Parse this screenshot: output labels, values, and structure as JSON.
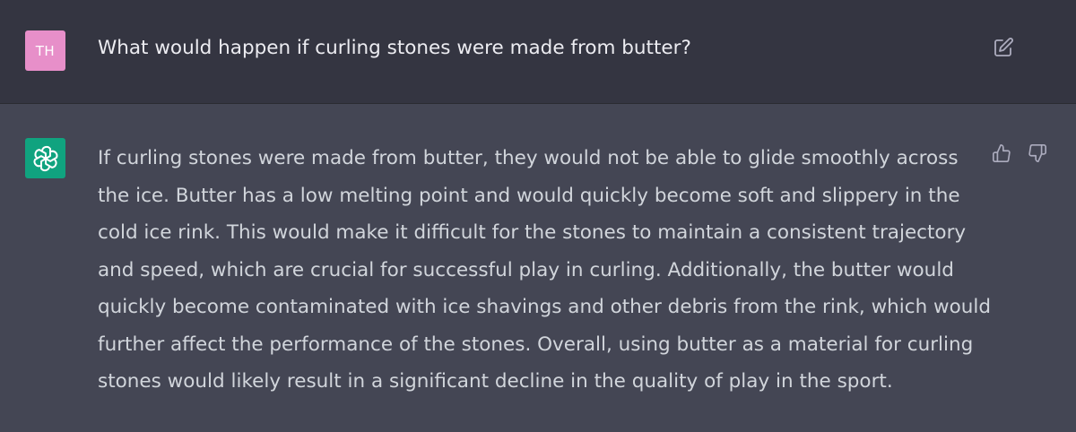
{
  "colors": {
    "user_avatar_bg": "#e78fc9",
    "assistant_avatar_bg": "#10a37f",
    "user_bg": "#343541",
    "assistant_bg": "#444654"
  },
  "user": {
    "avatar_initials": "TH",
    "message": "What would happen if curling stones were made from butter?",
    "edit_icon": "edit-icon"
  },
  "assistant": {
    "logo_icon": "openai-logo-icon",
    "message_lines": [
      "If curling stones were made from butter, they would not be able to glide smoothly across",
      "the ice. Butter has a low melting point and would quickly become soft and slippery in the",
      "cold ice rink. This would make it difficult for the stones to maintain a consistent trajectory",
      "and speed, which are crucial for successful play in curling. Additionally, the butter would",
      "quickly become contaminated with ice shavings and other debris from the rink, which would",
      "further affect the performance of the stones. Overall, using butter as a material for curling",
      "stones would likely result in a significant decline in the quality of play in the sport."
    ],
    "feedback_icons": [
      "thumbs-up-icon",
      "thumbs-down-icon"
    ]
  }
}
